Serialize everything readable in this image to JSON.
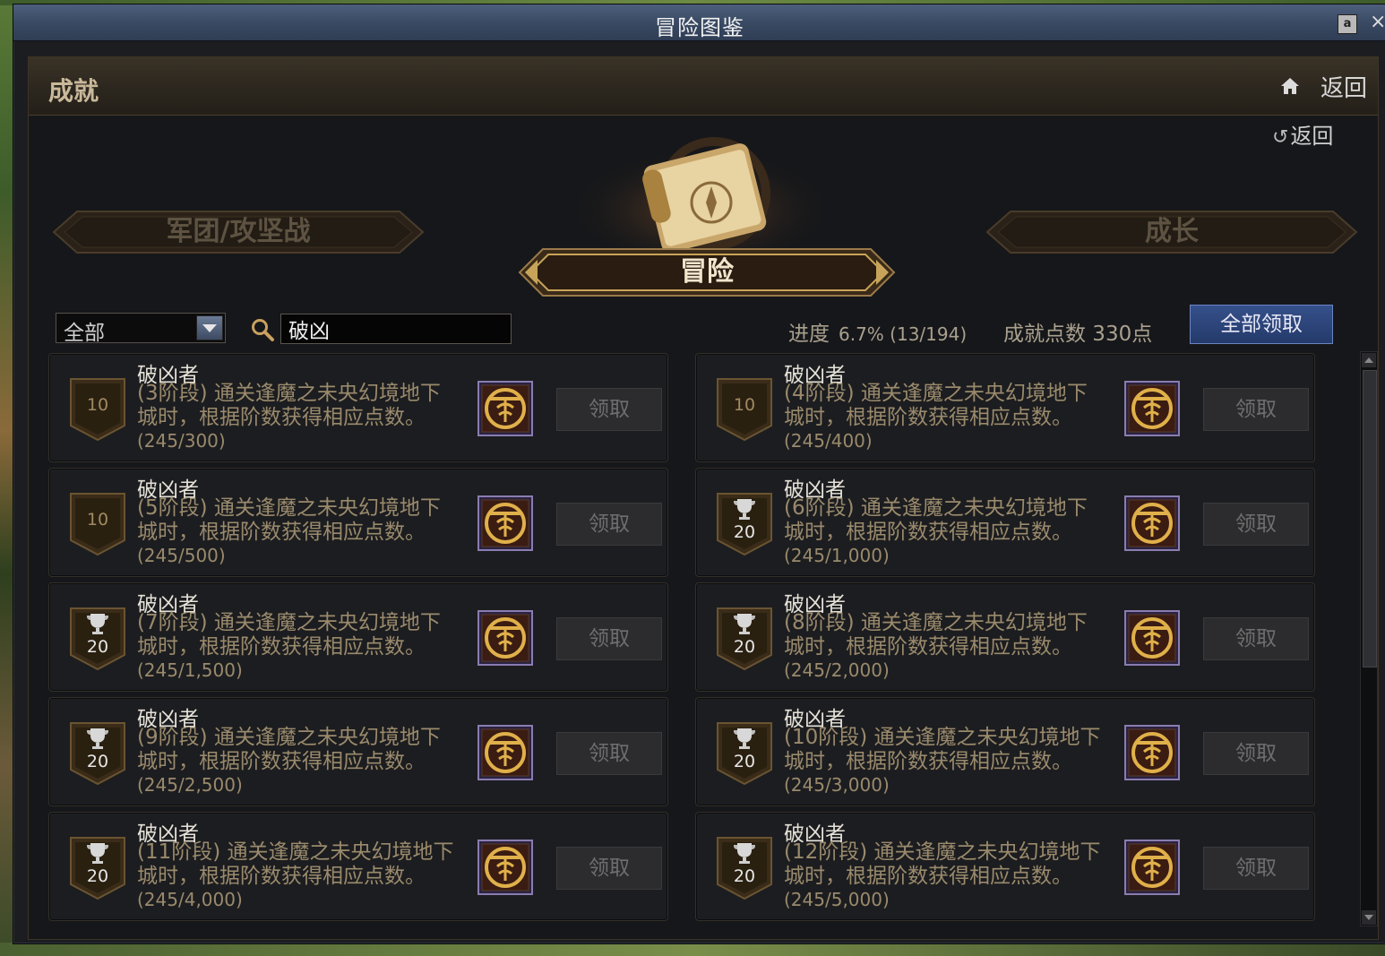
{
  "window": {
    "title": "冒险图鉴",
    "lock_label": "a",
    "close_label": "×"
  },
  "header": {
    "title": "成就",
    "back_label": "返回"
  },
  "sub_back": {
    "label": "返回"
  },
  "categories": {
    "left": "军团/攻坚战",
    "center": "冒险",
    "right": "成长"
  },
  "filter": {
    "selected": "全部"
  },
  "search": {
    "value": "破凶",
    "placeholder": ""
  },
  "progress": {
    "label": "进度",
    "value": "6.7% (13/194)"
  },
  "points": {
    "label": "成就点数 330点"
  },
  "claim_all": "全部领取",
  "cards": [
    {
      "title": "破凶者",
      "desc": "(3阶段) 通关逢魔之未央幻境地下城时，根据阶数获得相应点数。",
      "progress": "(245/300)",
      "points": "10",
      "trophy": false,
      "claim": "领取"
    },
    {
      "title": "破凶者",
      "desc": "(4阶段) 通关逢魔之未央幻境地下城时，根据阶数获得相应点数。",
      "progress": "(245/400)",
      "points": "10",
      "trophy": false,
      "claim": "领取"
    },
    {
      "title": "破凶者",
      "desc": "(5阶段) 通关逢魔之未央幻境地下城时，根据阶数获得相应点数。",
      "progress": "(245/500)",
      "points": "10",
      "trophy": false,
      "claim": "领取"
    },
    {
      "title": "破凶者",
      "desc": "(6阶段) 通关逢魔之未央幻境地下城时，根据阶数获得相应点数。",
      "progress": "(245/1,000)",
      "points": "20",
      "trophy": true,
      "claim": "领取"
    },
    {
      "title": "破凶者",
      "desc": "(7阶段) 通关逢魔之未央幻境地下城时，根据阶数获得相应点数。",
      "progress": "(245/1,500)",
      "points": "20",
      "trophy": true,
      "claim": "领取"
    },
    {
      "title": "破凶者",
      "desc": "(8阶段) 通关逢魔之未央幻境地下城时，根据阶数获得相应点数。",
      "progress": "(245/2,000)",
      "points": "20",
      "trophy": true,
      "claim": "领取"
    },
    {
      "title": "破凶者",
      "desc": "(9阶段) 通关逢魔之未央幻境地下城时，根据阶数获得相应点数。",
      "progress": "(245/2,500)",
      "points": "20",
      "trophy": true,
      "claim": "领取"
    },
    {
      "title": "破凶者",
      "desc": "(10阶段) 通关逢魔之未央幻境地下城时，根据阶数获得相应点数。",
      "progress": "(245/3,000)",
      "points": "20",
      "trophy": true,
      "claim": "领取"
    },
    {
      "title": "破凶者",
      "desc": "(11阶段) 通关逢魔之未央幻境地下城时，根据阶数获得相应点数。",
      "progress": "(245/4,000)",
      "points": "20",
      "trophy": true,
      "claim": "领取"
    },
    {
      "title": "破凶者",
      "desc": "(12阶段) 通关逢魔之未央幻境地下城时，根据阶数获得相应点数。",
      "progress": "(245/5,000)",
      "points": "20",
      "trophy": true,
      "claim": "领取"
    }
  ],
  "icons": {
    "home": "home-icon",
    "back": "return-arrow-icon",
    "search": "search-icon",
    "badge": "gold-emblem-icon",
    "trophy": "trophy-icon",
    "scroll": "scroll-compass-icon"
  },
  "colors": {
    "accent_blue": "#2f4a7e",
    "gold": "#c8a45a"
  }
}
